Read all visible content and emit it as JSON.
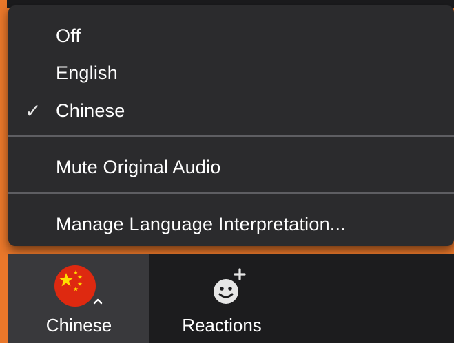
{
  "menu": {
    "items": [
      {
        "label": "Off",
        "checked": false
      },
      {
        "label": "English",
        "checked": false
      },
      {
        "label": "Chinese",
        "checked": true
      }
    ],
    "mute_label": "Mute Original Audio",
    "manage_label": "Manage Language Interpretation...",
    "check_glyph": "✓"
  },
  "toolbar": {
    "interpretation": {
      "label": "Chinese",
      "icon": "china-flag-icon"
    },
    "reactions": {
      "label": "Reactions",
      "icon": "add-reaction-icon"
    }
  },
  "colors": {
    "background": "#e9772a",
    "menu_bg": "#2b2b2d",
    "toolbar_bg": "#1c1c1e",
    "selected_button_bg": "#39393c",
    "flag_red": "#de2910",
    "flag_star": "#ffde00"
  }
}
